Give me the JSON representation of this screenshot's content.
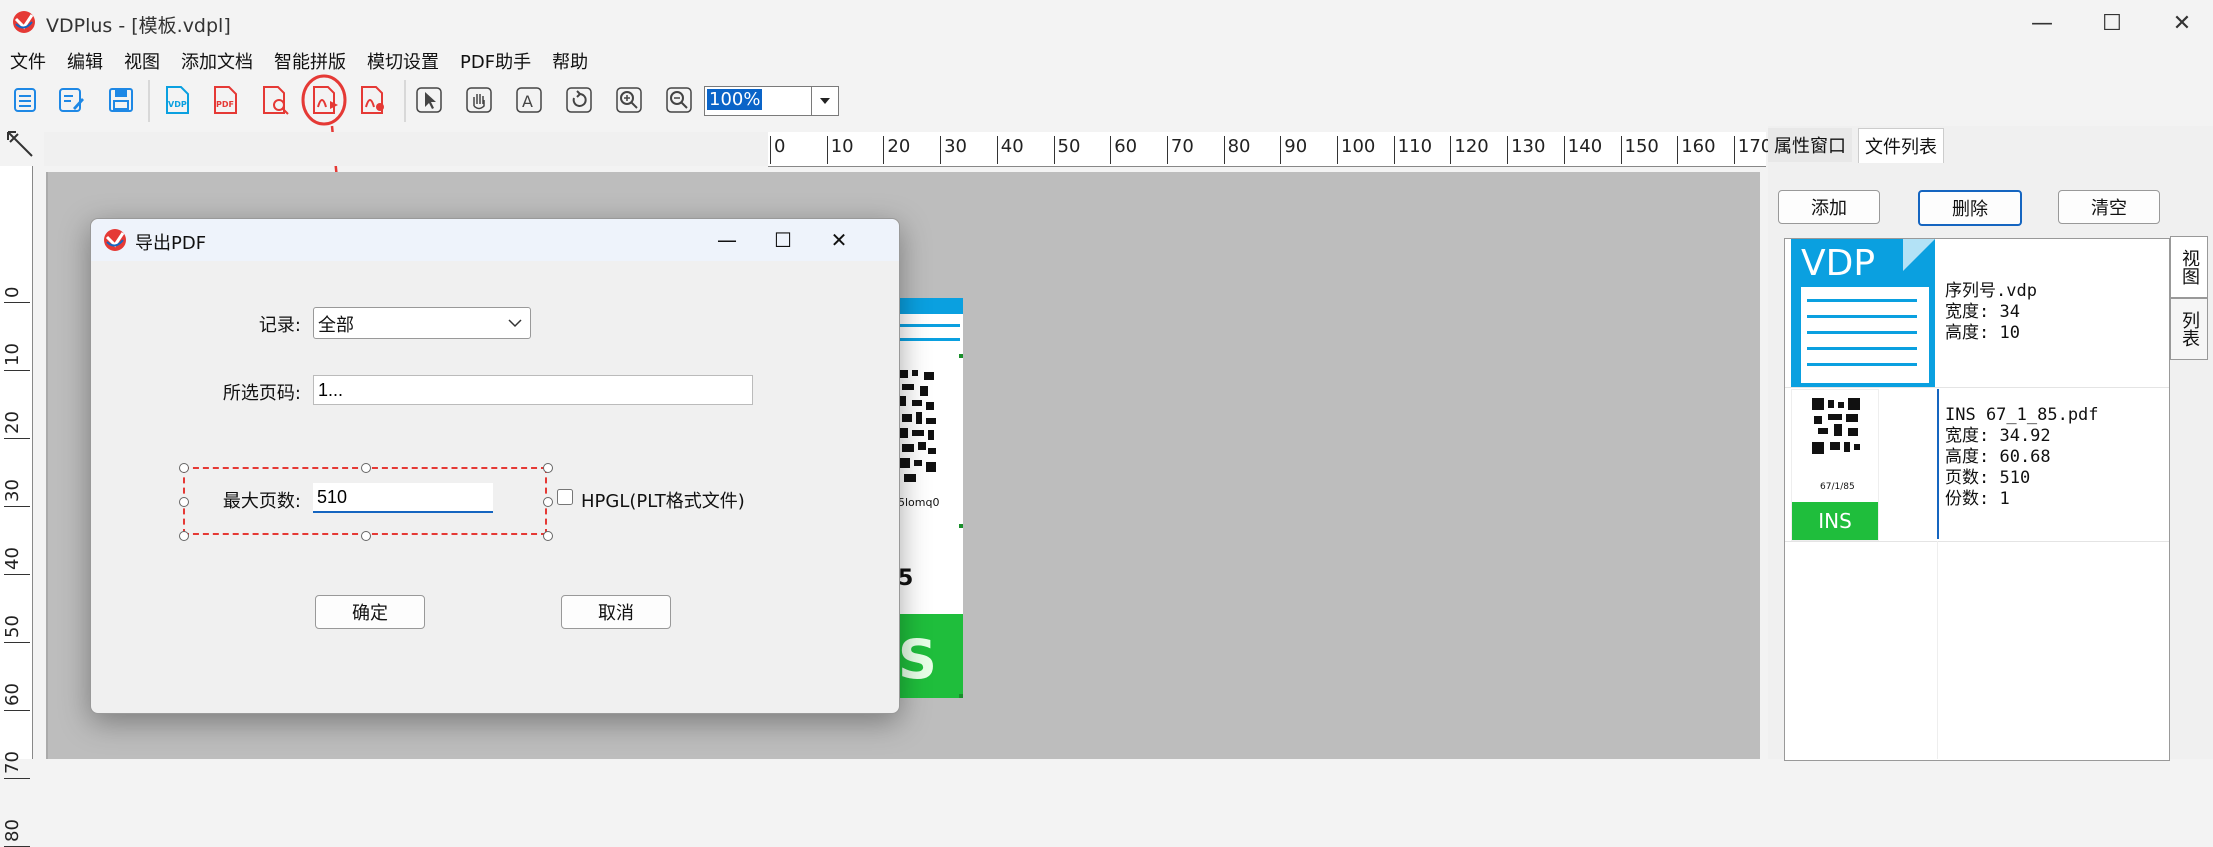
{
  "window": {
    "title": "VDPlus - [模板.vdpl]",
    "minimize": "—",
    "maximize": "☐",
    "close": "✕"
  },
  "menu": [
    "文件",
    "编辑",
    "视图",
    "添加文档",
    "智能拼版",
    "模切设置",
    "PDF助手",
    "帮助"
  ],
  "toolbar": {
    "zoom_value": "100%",
    "icons": [
      "list-icon",
      "edit-icon",
      "save-icon",
      "vdp-icon",
      "pdf-icon",
      "pdf-search-icon",
      "pdf-export-icon",
      "pdf-settings-icon",
      "select-arrow-icon",
      "hand-icon",
      "text-icon",
      "rotate-icon",
      "zoom-in-icon",
      "zoom-out-icon"
    ]
  },
  "ruler": {
    "h_ticks": [
      "0",
      "10",
      "20",
      "30",
      "40",
      "50",
      "60",
      "70",
      "80",
      "90",
      "100",
      "110",
      "120",
      "130",
      "140",
      "150",
      "160",
      "170"
    ],
    "v_ticks": [
      "0",
      "10",
      "20",
      "30",
      "40",
      "50",
      "60",
      "70",
      "80"
    ]
  },
  "canvas": {
    "label_text_fragment": "5lomq0",
    "label_big_fragment": "5",
    "label_green_fragment": "S"
  },
  "dialog": {
    "title": "导出PDF",
    "minimize": "—",
    "maximize": "☐",
    "close": "✕",
    "record_label": "记录:",
    "record_value": "全部",
    "pages_label": "所选页码:",
    "pages_value": "1...",
    "max_pages_label": "最大页数:",
    "max_pages_value": "510",
    "hpgl_label": "HPGL(PLT格式文件)",
    "ok": "确定",
    "cancel": "取消"
  },
  "panel": {
    "tab_properties": "属性窗口",
    "tab_files": "文件列表",
    "add": "添加",
    "delete": "删除",
    "clear": "清空",
    "side_tab_view": "视图",
    "side_tab_list": "列表",
    "files": [
      {
        "thumb_text": "VDP",
        "name": "序列号.vdp",
        "width": "宽度: 34",
        "height": "高度: 10"
      },
      {
        "thumb_text": "INS",
        "thumb_caption": "67/1/85",
        "name": "INS 67_1_85.pdf",
        "width": "宽度: 34.92",
        "height": "高度: 60.68",
        "pages": "页数: 510",
        "copies": "份数: 1"
      }
    ]
  },
  "colors": {
    "accent_red": "#e53935",
    "vdp_blue": "#0aa0e0",
    "ins_green": "#1fbe3c",
    "selection_blue": "#0a64c8"
  }
}
